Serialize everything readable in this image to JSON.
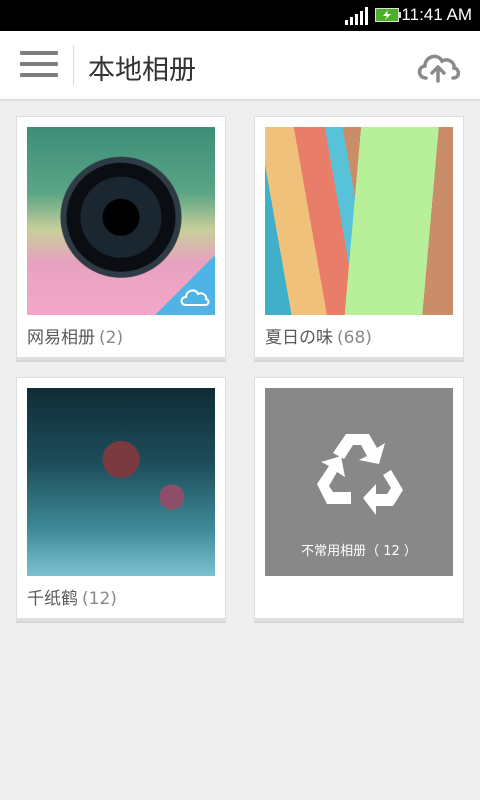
{
  "status_bar": {
    "time": "11:41 AM",
    "signal_icon": "signal-bars-icon",
    "battery_icon": "battery-charging-icon"
  },
  "header": {
    "title": "本地相册",
    "menu_icon": "hamburger-menu-icon",
    "upload_icon": "cloud-upload-icon"
  },
  "albums": [
    {
      "name": "网易相册",
      "count": "(2)",
      "thumbnail": "camera-lens-photo",
      "badge_icon": "cloud-icon"
    },
    {
      "name": "夏日の味",
      "count": "(68)",
      "thumbnail": "sticky-notes-photo"
    },
    {
      "name": "千纸鹤",
      "count": "(12)",
      "thumbnail": "flower-bud-photo"
    },
    {
      "label": "不常用相册（ 12 ）",
      "thumbnail": "recycle-icon"
    }
  ],
  "colors": {
    "accent": "#4fb3e6",
    "background": "#efefef",
    "recycle_tile": "#888888"
  }
}
